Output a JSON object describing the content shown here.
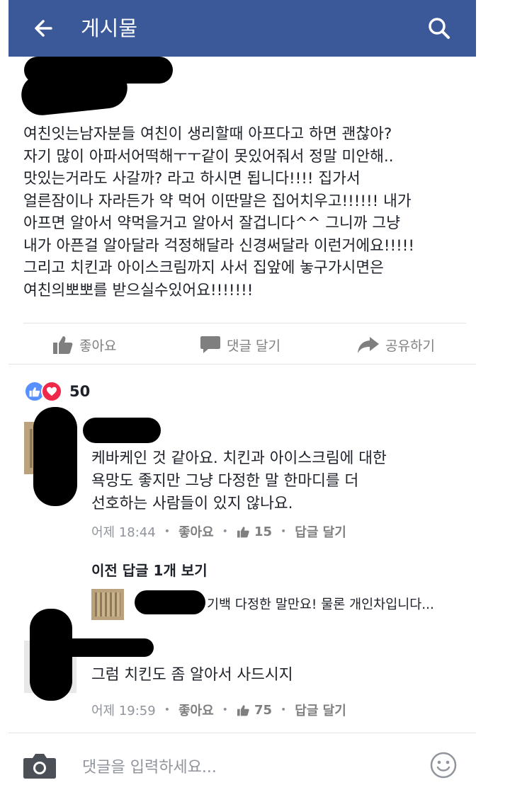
{
  "header": {
    "title": "게시물"
  },
  "post": {
    "text": "여친잇는남자분들 여친이 생리할때 아프다고 하면 괜찮아?\n자기 많이 아파서어떡해ㅜㅜ같이 못있어줘서 정말 미안해..\n맛있는거라도 사갈까? 라고 하시면 됩니다!!!! 집가서\n얼른잠이나 자라든가 약 먹어 이딴말은 집어치우고!!!!!! 내가\n아프면 알아서 약먹을거고 알아서 잘겁니다^^ 그니까 그냥\n내가 아픈걸 알아달라 걱정해달라 신경써달라 이런거에요!!!!!\n그리고 치킨과 아이스크림까지 사서 집앞에 놓구가시면은\n여친의뽀뽀를 받으실수있어요!!!!!!!"
  },
  "actions": {
    "like": "좋아요",
    "comment": "댓글 달기",
    "share": "공유하기"
  },
  "reactions": {
    "count": "50"
  },
  "comments": [
    {
      "text": "케바케인 것 같아요. 치킨과 아이스크림에 대한\n욕망도 좋지만 그냥 다정한 말 한마디를 더\n선호하는 사람들이 있지 않나요.",
      "time": "어제 18:44",
      "like_label": "좋아요",
      "likes": "15",
      "reply_label": "답글 달기"
    },
    {
      "text": "그럼 치킨도 좀 알아서 사드시지",
      "time": "어제 19:59",
      "like_label": "좋아요",
      "likes": "75",
      "reply_label": "답글 달기"
    }
  ],
  "replies": {
    "toggle_label": "이전 답글 1개 보기",
    "preview_text": "기백 다정한 말만요! 물론 개인차입니다..."
  },
  "composer": {
    "placeholder": "댓글을 입력하세요..."
  },
  "colors": {
    "header": "#3b5998",
    "like_reaction": "#5890ff",
    "love_reaction": "#f0284a",
    "muted_text": "#90949c"
  },
  "icons": [
    "back-arrow-icon",
    "search-icon",
    "thumbs-up-icon",
    "comment-bubble-icon",
    "share-arrow-icon",
    "heart-icon",
    "camera-icon",
    "smiley-icon"
  ]
}
